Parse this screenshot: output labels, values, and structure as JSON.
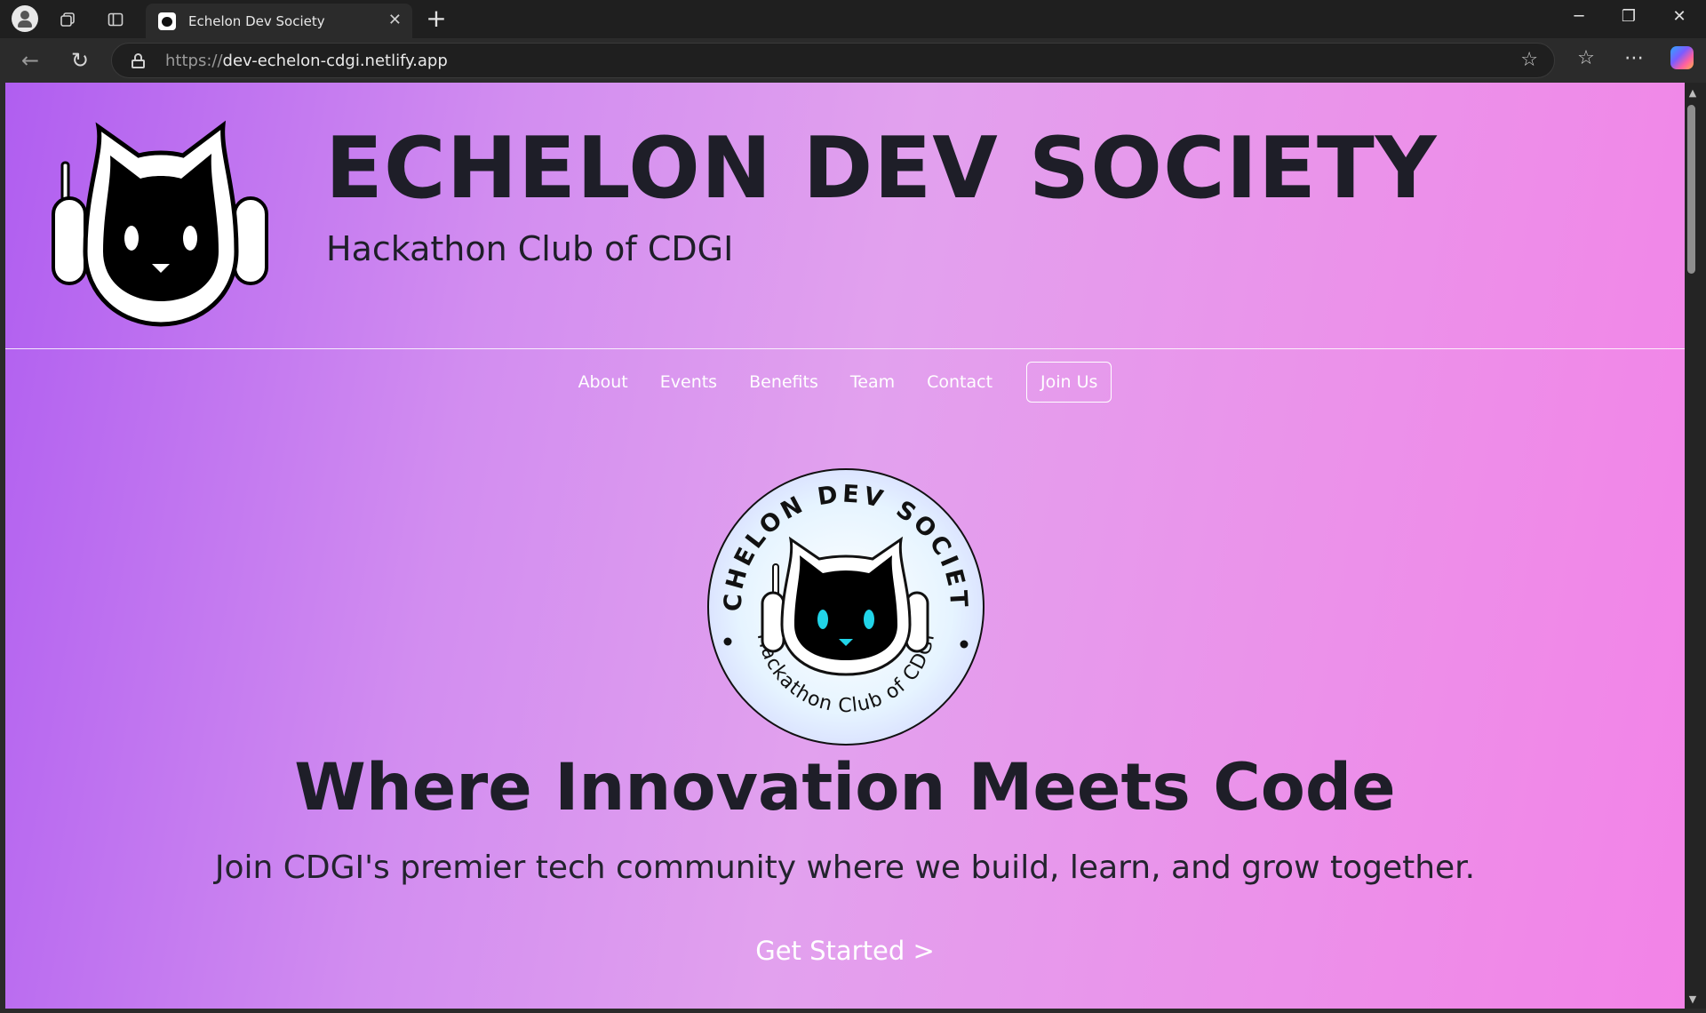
{
  "browser": {
    "tab_title": "Echelon Dev Society",
    "url_protocol": "https://",
    "url_host": "dev-echelon-cdgi.netlify.app"
  },
  "site": {
    "brand_title": "ECHELON DEV SOCIETY",
    "brand_subtitle": "Hackathon Club of CDGI",
    "nav": {
      "about": "About",
      "events": "Events",
      "benefits": "Benefits",
      "team": "Team",
      "contact": "Contact",
      "join": "Join Us"
    },
    "emblem": {
      "top_text": "ECHELON DEV SOCIETY",
      "bottom_text": "Hackathon Club of CDGI"
    },
    "hero": {
      "title": "Where Innovation Meets Code",
      "subtitle": "Join CDGI's premier tech community where we build, learn, and grow together.",
      "cta": "Get Started >"
    }
  },
  "colors": {
    "gradient_start": "#b05ef0",
    "gradient_mid": "#e2a1ee",
    "gradient_end": "#f383e7",
    "text_dark": "#1e1e28",
    "emblem_eye": "#21d4e8"
  }
}
